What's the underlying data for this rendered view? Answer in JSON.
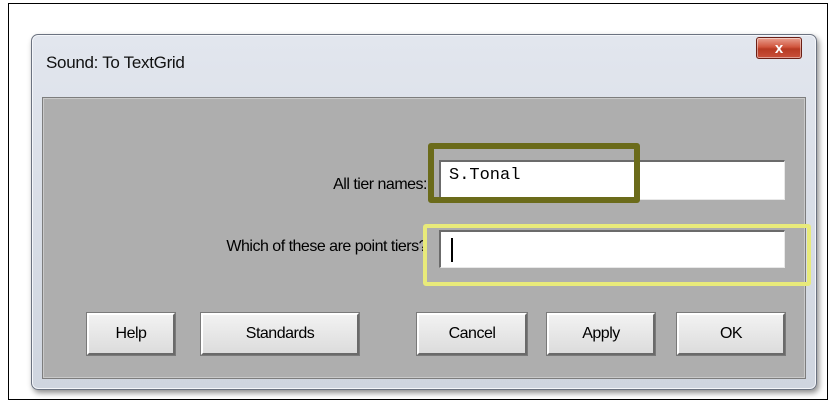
{
  "window": {
    "title": "Sound: To TextGrid",
    "close_glyph": "x"
  },
  "form": {
    "all_tier_names": {
      "label": "All tier names:",
      "value": "S.Tonal"
    },
    "point_tiers": {
      "label": "Which of these are point tiers?",
      "value": ""
    }
  },
  "buttons": {
    "help": "Help",
    "standards": "Standards",
    "cancel": "Cancel",
    "apply": "Apply",
    "ok": "OK"
  },
  "highlights": {
    "dark_color": "#6b6b1a",
    "light_color": "#e8ea7a"
  }
}
